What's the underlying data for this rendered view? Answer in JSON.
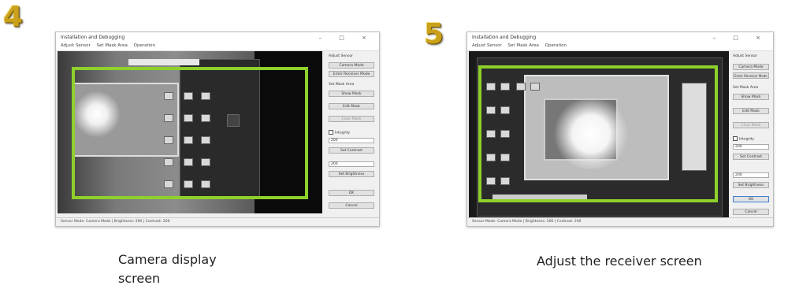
{
  "steps": [
    "4",
    "5"
  ],
  "window": {
    "title": "Installation and Debugging",
    "controls": "–   □   ×",
    "menu": [
      "Adjust Sensor",
      "Set Mask Area",
      "Operation"
    ]
  },
  "left": {
    "panel": {
      "group1": "Adjust Sensor",
      "btn_camera_mode": "Camera Mode",
      "btn_receiver_mode": "Enter Receiver Mode",
      "group2": "Set Mask Area",
      "btn_show_mask": "Show Mask",
      "btn_edit_mask": "Edit Mask",
      "btn_clear_mask": "Clear Mask",
      "chk_integrity": "Integrity",
      "field1": "200",
      "btn_set_contrast": "Set Contrast",
      "field2": "200",
      "btn_set_brightness": "Set Brightness",
      "btn_ok": "OK",
      "btn_cancel": "Cancel"
    },
    "status": "Sensor Mode: Camera Mode  |  Brightness: 200  |  Contrast: 200",
    "caption": [
      "Camera display",
      "screen"
    ]
  },
  "right": {
    "panel": {
      "group1": "Adjust Sensor",
      "btn_camera_mode": "Camera Mode",
      "btn_receiver_mode": "Enter Receiver Mode",
      "group2": "Set Mask Area",
      "btn_show_mask": "Show Mask",
      "btn_edit_mask": "Edit Mask",
      "btn_clear_mask": "Clear Mask",
      "chk_integrity": "Integrity",
      "field1": "200",
      "btn_set_contrast": "Set Contrast",
      "field2": "200",
      "btn_set_brightness": "Set Brightness",
      "btn_ok": "OK",
      "btn_cancel": "Cancel"
    },
    "status": "Sensor Mode: Camera Mode  |  Brightness: 200  |  Contrast: 200",
    "caption": "Adjust the receiver screen"
  },
  "colors": {
    "highlight": "#8ed12a",
    "step_number": "#c9a11b"
  }
}
